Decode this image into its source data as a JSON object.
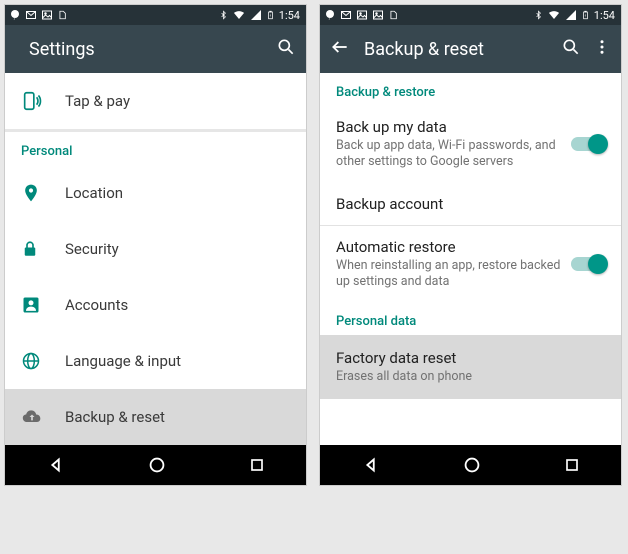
{
  "statusbar": {
    "time": "1:54"
  },
  "left": {
    "header": {
      "title": "Settings"
    },
    "row_tap_pay": "Tap & pay",
    "section_personal": "Personal",
    "rows": {
      "location": "Location",
      "security": "Security",
      "accounts": "Accounts",
      "language": "Language & input",
      "backup": "Backup & reset"
    }
  },
  "right": {
    "header": {
      "title": "Backup & reset"
    },
    "section_backup_restore": "Backup & restore",
    "backup_data": {
      "title": "Back up my data",
      "sub": "Back up app data, Wi-Fi passwords, and other settings to Google servers"
    },
    "backup_account": {
      "title": "Backup account"
    },
    "auto_restore": {
      "title": "Automatic restore",
      "sub": "When reinstalling an app, restore backed up settings and data"
    },
    "section_personal_data": "Personal data",
    "factory_reset": {
      "title": "Factory data reset",
      "sub": "Erases all data on phone"
    }
  }
}
